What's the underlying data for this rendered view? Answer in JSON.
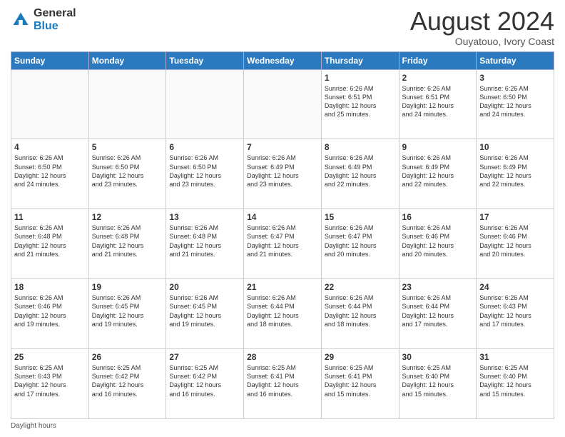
{
  "logo": {
    "line1": "General",
    "line2": "Blue"
  },
  "title": "August 2024",
  "subtitle": "Ouyatouo, Ivory Coast",
  "days_of_week": [
    "Sunday",
    "Monday",
    "Tuesday",
    "Wednesday",
    "Thursday",
    "Friday",
    "Saturday"
  ],
  "footer": "Daylight hours",
  "weeks": [
    [
      {
        "day": "",
        "info": ""
      },
      {
        "day": "",
        "info": ""
      },
      {
        "day": "",
        "info": ""
      },
      {
        "day": "",
        "info": ""
      },
      {
        "day": "1",
        "info": "Sunrise: 6:26 AM\nSunset: 6:51 PM\nDaylight: 12 hours\nand 25 minutes."
      },
      {
        "day": "2",
        "info": "Sunrise: 6:26 AM\nSunset: 6:51 PM\nDaylight: 12 hours\nand 24 minutes."
      },
      {
        "day": "3",
        "info": "Sunrise: 6:26 AM\nSunset: 6:50 PM\nDaylight: 12 hours\nand 24 minutes."
      }
    ],
    [
      {
        "day": "4",
        "info": "Sunrise: 6:26 AM\nSunset: 6:50 PM\nDaylight: 12 hours\nand 24 minutes."
      },
      {
        "day": "5",
        "info": "Sunrise: 6:26 AM\nSunset: 6:50 PM\nDaylight: 12 hours\nand 23 minutes."
      },
      {
        "day": "6",
        "info": "Sunrise: 6:26 AM\nSunset: 6:50 PM\nDaylight: 12 hours\nand 23 minutes."
      },
      {
        "day": "7",
        "info": "Sunrise: 6:26 AM\nSunset: 6:49 PM\nDaylight: 12 hours\nand 23 minutes."
      },
      {
        "day": "8",
        "info": "Sunrise: 6:26 AM\nSunset: 6:49 PM\nDaylight: 12 hours\nand 22 minutes."
      },
      {
        "day": "9",
        "info": "Sunrise: 6:26 AM\nSunset: 6:49 PM\nDaylight: 12 hours\nand 22 minutes."
      },
      {
        "day": "10",
        "info": "Sunrise: 6:26 AM\nSunset: 6:49 PM\nDaylight: 12 hours\nand 22 minutes."
      }
    ],
    [
      {
        "day": "11",
        "info": "Sunrise: 6:26 AM\nSunset: 6:48 PM\nDaylight: 12 hours\nand 21 minutes."
      },
      {
        "day": "12",
        "info": "Sunrise: 6:26 AM\nSunset: 6:48 PM\nDaylight: 12 hours\nand 21 minutes."
      },
      {
        "day": "13",
        "info": "Sunrise: 6:26 AM\nSunset: 6:48 PM\nDaylight: 12 hours\nand 21 minutes."
      },
      {
        "day": "14",
        "info": "Sunrise: 6:26 AM\nSunset: 6:47 PM\nDaylight: 12 hours\nand 21 minutes."
      },
      {
        "day": "15",
        "info": "Sunrise: 6:26 AM\nSunset: 6:47 PM\nDaylight: 12 hours\nand 20 minutes."
      },
      {
        "day": "16",
        "info": "Sunrise: 6:26 AM\nSunset: 6:46 PM\nDaylight: 12 hours\nand 20 minutes."
      },
      {
        "day": "17",
        "info": "Sunrise: 6:26 AM\nSunset: 6:46 PM\nDaylight: 12 hours\nand 20 minutes."
      }
    ],
    [
      {
        "day": "18",
        "info": "Sunrise: 6:26 AM\nSunset: 6:46 PM\nDaylight: 12 hours\nand 19 minutes."
      },
      {
        "day": "19",
        "info": "Sunrise: 6:26 AM\nSunset: 6:45 PM\nDaylight: 12 hours\nand 19 minutes."
      },
      {
        "day": "20",
        "info": "Sunrise: 6:26 AM\nSunset: 6:45 PM\nDaylight: 12 hours\nand 19 minutes."
      },
      {
        "day": "21",
        "info": "Sunrise: 6:26 AM\nSunset: 6:44 PM\nDaylight: 12 hours\nand 18 minutes."
      },
      {
        "day": "22",
        "info": "Sunrise: 6:26 AM\nSunset: 6:44 PM\nDaylight: 12 hours\nand 18 minutes."
      },
      {
        "day": "23",
        "info": "Sunrise: 6:26 AM\nSunset: 6:44 PM\nDaylight: 12 hours\nand 17 minutes."
      },
      {
        "day": "24",
        "info": "Sunrise: 6:26 AM\nSunset: 6:43 PM\nDaylight: 12 hours\nand 17 minutes."
      }
    ],
    [
      {
        "day": "25",
        "info": "Sunrise: 6:25 AM\nSunset: 6:43 PM\nDaylight: 12 hours\nand 17 minutes."
      },
      {
        "day": "26",
        "info": "Sunrise: 6:25 AM\nSunset: 6:42 PM\nDaylight: 12 hours\nand 16 minutes."
      },
      {
        "day": "27",
        "info": "Sunrise: 6:25 AM\nSunset: 6:42 PM\nDaylight: 12 hours\nand 16 minutes."
      },
      {
        "day": "28",
        "info": "Sunrise: 6:25 AM\nSunset: 6:41 PM\nDaylight: 12 hours\nand 16 minutes."
      },
      {
        "day": "29",
        "info": "Sunrise: 6:25 AM\nSunset: 6:41 PM\nDaylight: 12 hours\nand 15 minutes."
      },
      {
        "day": "30",
        "info": "Sunrise: 6:25 AM\nSunset: 6:40 PM\nDaylight: 12 hours\nand 15 minutes."
      },
      {
        "day": "31",
        "info": "Sunrise: 6:25 AM\nSunset: 6:40 PM\nDaylight: 12 hours\nand 15 minutes."
      }
    ]
  ]
}
